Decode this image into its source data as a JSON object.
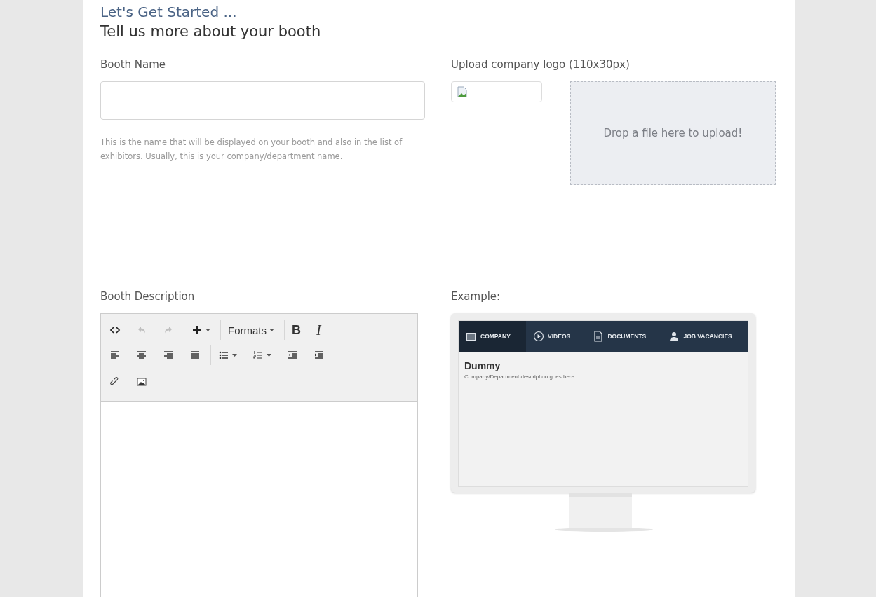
{
  "heading": {
    "title": "Let's Get Started ...",
    "subtitle": "Tell us more about your booth"
  },
  "booth_name": {
    "label": "Booth Name",
    "help": "This is the name that will be displayed on your booth and also in the list of exhibitors. Usually, this is your company/department name."
  },
  "logo_upload": {
    "label": "Upload company logo (110x30px)",
    "dropzone": "Drop a file here to upload!"
  },
  "booth_description": {
    "label": "Booth Description",
    "toolbar": [
      [
        {
          "kind": "code",
          "disabled": false
        },
        {
          "kind": "undo",
          "disabled": true
        },
        {
          "kind": "redo",
          "disabled": true
        },
        {
          "kind": "insert",
          "disabled": false
        },
        {
          "kind": "formats",
          "label": "Formats",
          "disabled": false
        },
        {
          "kind": "bold",
          "label": "B",
          "disabled": false
        },
        {
          "kind": "italic",
          "label": "I",
          "disabled": false
        }
      ],
      [
        {
          "kind": "alignleft",
          "disabled": false
        },
        {
          "kind": "aligncenter",
          "disabled": false
        },
        {
          "kind": "alignright",
          "disabled": false
        },
        {
          "kind": "justify",
          "disabled": false
        },
        {
          "kind": "bullets",
          "disabled": false
        },
        {
          "kind": "numbers",
          "disabled": false
        },
        {
          "kind": "outdent",
          "disabled": false
        },
        {
          "kind": "indent",
          "disabled": false
        }
      ],
      [
        {
          "kind": "link",
          "disabled": false
        },
        {
          "kind": "image",
          "disabled": false
        }
      ]
    ]
  },
  "example": {
    "label": "Example:",
    "tabs": [
      {
        "label": "COMPANY",
        "kind": "building",
        "selected": true
      },
      {
        "label": "VIDEOS",
        "kind": "play",
        "selected": false
      },
      {
        "label": "DOCUMENTS",
        "kind": "document",
        "selected": false
      },
      {
        "label": "JOB VACANCIES",
        "kind": "person",
        "selected": false
      }
    ],
    "title": "Dummy",
    "description": "Company/Department description goes here."
  }
}
